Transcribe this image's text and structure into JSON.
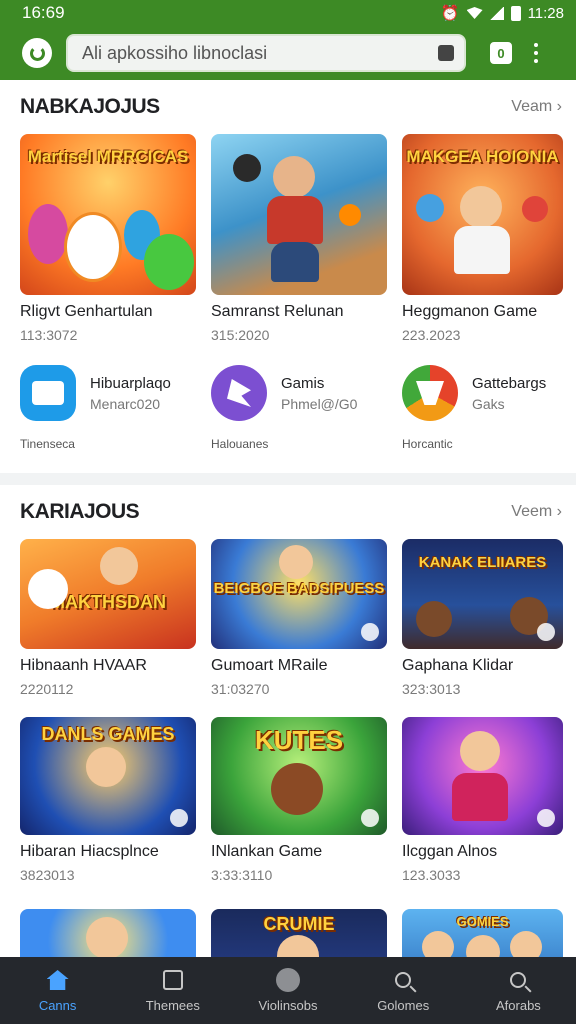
{
  "status": {
    "time": "16:69",
    "right_time": "11:28"
  },
  "toolbar": {
    "search_text": "Ali apkossiho libnoclasi"
  },
  "section1": {
    "title": "NABKAJOJUS",
    "view": "Veam",
    "cards": [
      {
        "thumb_title": "Martisel MRRCICAS",
        "name": "Rligvt Genhartulan",
        "meta": "113:3072",
        "bg": "#ff7b25"
      },
      {
        "thumb_title": "",
        "name": "Samranst Relunan",
        "meta": "315:2020",
        "bg": "#3d92c9"
      },
      {
        "thumb_title": "MAKGEA HOIONIA",
        "name": "Heggmanon Game",
        "meta": "223.2023",
        "bg": "#e5682e"
      }
    ],
    "apps": [
      {
        "name": "Hibuarplaqo",
        "sub": "Menarc020",
        "tag": "Tinenseca",
        "icon_color": "#1e9be8"
      },
      {
        "name": "Gamis",
        "sub": "Phmel@/G0",
        "tag": "Halouanes",
        "icon_color": "#7c4fd1"
      },
      {
        "name": "Gattebargs",
        "sub": "Gaks",
        "tag": "Horcantic",
        "icon_color": "#f29a15"
      }
    ]
  },
  "section2": {
    "title": "KARIAJOUS",
    "view": "Veem",
    "rows": [
      [
        {
          "thumb_title": "MAKTHSDAN",
          "name": "Hibnaanh HVAAR",
          "meta": "2220112",
          "bg": "#f07c2a"
        },
        {
          "thumb_title": "BEIGBOE BADSIPUESS",
          "name": "Gumoart MRaile",
          "meta": "31:03270",
          "bg": "#3a7bd5"
        },
        {
          "thumb_title": "KANAK ELIIARES",
          "name": "Gaphana Klidar",
          "meta": "323:3013",
          "bg": "#27509b"
        }
      ],
      [
        {
          "thumb_title": "DANLS GAMES",
          "name": "Hibaran Hiacsplnce",
          "meta": "3823013",
          "bg": "#1f4fb3"
        },
        {
          "thumb_title": "KUTES",
          "name": "INlankan Game",
          "meta": "3:33:3110",
          "bg": "#3ba43b"
        },
        {
          "thumb_title": "",
          "name": "Ilcggan Alnos",
          "meta": "123.3033",
          "bg": "#8c3fd6"
        }
      ],
      [
        {
          "thumb_title": "",
          "name": "",
          "meta": "",
          "bg": "#3e8df0"
        },
        {
          "thumb_title": "CRUMIE",
          "name": "",
          "meta": "",
          "bg": "#27408c"
        },
        {
          "thumb_title": "GOMIES",
          "name": "",
          "meta": "",
          "bg": "#2e6fbd"
        }
      ]
    ]
  },
  "nav": [
    {
      "label": "Canns",
      "icon": "home-icon"
    },
    {
      "label": "Themees",
      "icon": "frame-icon"
    },
    {
      "label": "Violinsobs",
      "icon": "circle-icon"
    },
    {
      "label": "Golomes",
      "icon": "search-icon"
    },
    {
      "label": "Aforabs",
      "icon": "search-icon"
    }
  ]
}
